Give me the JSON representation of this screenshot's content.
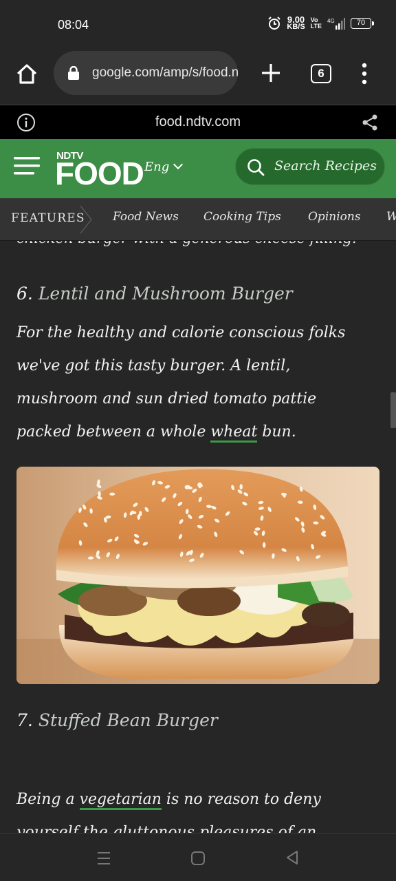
{
  "status_bar": {
    "time": "08:04",
    "net_speed_value": "9.00",
    "net_speed_unit": "KB/S",
    "volte_top": "Vo",
    "volte_bottom": "LTE",
    "network": "4G",
    "battery": "70"
  },
  "browser": {
    "url": "google.com/amp/s/food.ndtv.com",
    "tab_count": "6"
  },
  "site_bar": {
    "domain": "food.ndtv.com"
  },
  "header": {
    "logo_top": "NDTV",
    "logo_main": "FOOD",
    "language": "Eng",
    "search_label": "Search Recipes",
    "brand_color": "#3c8d45"
  },
  "categories": {
    "features": "FEATURES",
    "items": [
      "Food News",
      "Cooking Tips",
      "Opinions",
      "W"
    ]
  },
  "article": {
    "cut_line": "chicken burger with a generous cheese filling.",
    "item6": {
      "number": "6.",
      "title": "Lentil and Mushroom Burger",
      "lines": [
        "For the healthy and calorie conscious folks",
        "we've got this tasty burger. A lentil,",
        "mushroom and sun dried tomato pattie"
      ],
      "last_line_before": "packed between a whole ",
      "link": "wheat",
      "last_line_after": " bun."
    },
    "item7": {
      "number": "7.",
      "title": "Stuffed Bean Burger",
      "line_before": "Being a ",
      "link": "vegetarian",
      "line_after": " is no reason to deny",
      "cut_line": "yourself the gluttonous pleasures of an"
    }
  }
}
